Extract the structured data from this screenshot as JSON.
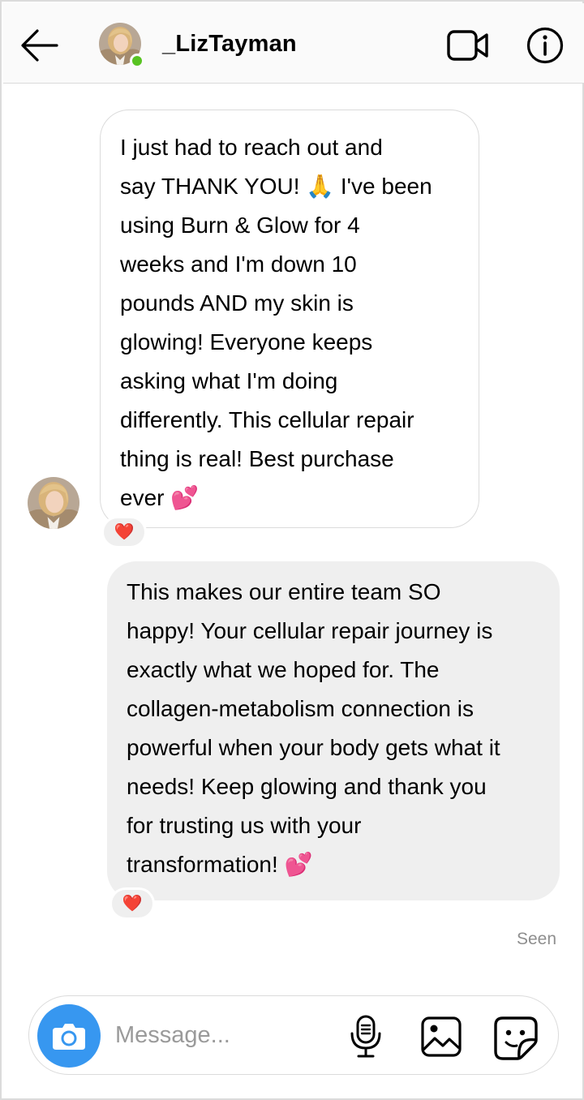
{
  "header": {
    "username": "_LizTayman",
    "online": true
  },
  "messages": [
    {
      "direction": "incoming",
      "text": " I just had to reach out and\nsay THANK YOU! 🙏 I've been\nusing Burn & Glow for 4\nweeks and I'm down 10\npounds AND my skin is\nglowing! Everyone keeps\nasking what I'm doing\ndifferently. This cellular repair\nthing is real! Best purchase\never 💕",
      "reaction": "❤️"
    },
    {
      "direction": "outgoing",
      "text": "This makes our entire team SO\nhappy! Your cellular repair journey is\nexactly what we hoped for. The\ncollagen-metabolism connection is\npowerful when your body gets what it\nneeds! Keep glowing and thank you\nfor trusting us with your\ntransformation! 💕",
      "reaction": "❤️"
    }
  ],
  "status": {
    "seen_label": "Seen"
  },
  "composer": {
    "placeholder": "Message..."
  },
  "icons": {
    "back": "arrow-left-icon",
    "video": "video-camera-icon",
    "info": "info-icon",
    "camera": "camera-icon",
    "mic": "microphone-icon",
    "gallery": "image-icon",
    "sticker": "sticker-icon"
  },
  "colors": {
    "accent": "#3797f0",
    "online": "#58c322",
    "outgoing_bubble": "#efefef",
    "border": "#dbdbdb",
    "muted_text": "#8e8e8e"
  }
}
